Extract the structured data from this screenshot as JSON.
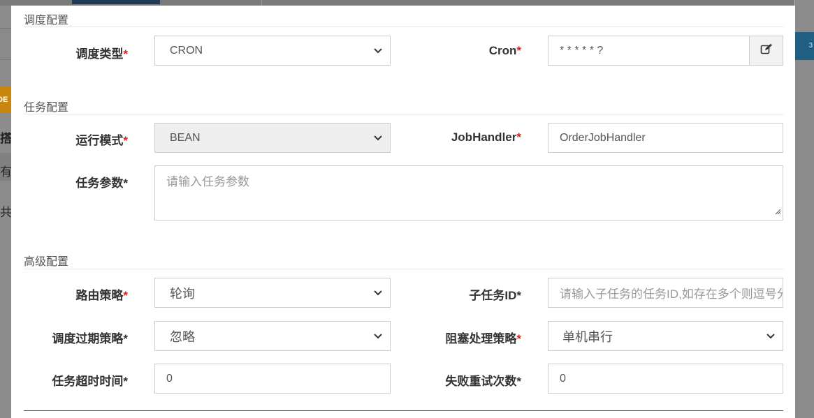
{
  "background": {
    "badge_text": "DE",
    "row1_text": "搭",
    "row2_text": "有",
    "row3_text": "共",
    "right_text": "3"
  },
  "sections": {
    "schedule": "调度配置",
    "task": "任务配置",
    "advanced": "高级配置"
  },
  "schedule": {
    "type_label": "调度类型",
    "type_value": "CRON",
    "cron_label": "Cron",
    "cron_value": "* * * * * ?"
  },
  "task": {
    "mode_label": "运行模式",
    "mode_value": "BEAN",
    "handler_label": "JobHandler",
    "handler_value": "OrderJobHandler",
    "param_label": "任务参数",
    "param_placeholder": "请输入任务参数"
  },
  "advanced": {
    "route_label": "路由策略",
    "route_value": "轮询",
    "child_label": "子任务ID",
    "child_placeholder": "请输入子任务的任务ID,如存在多个则逗号分隔",
    "misfire_label": "调度过期策略",
    "misfire_value": "忽略",
    "block_label": "阻塞处理策略",
    "block_value": "单机串行",
    "timeout_label": "任务超时时间",
    "timeout_value": "0",
    "retry_label": "失败重试次数",
    "retry_value": "0"
  },
  "required_mark": "*",
  "icons": {
    "select": "chevron-down-icon",
    "cron_edit": "edit-icon",
    "resize": "resize-handle-icon"
  },
  "colors": {
    "required": "#d9231d",
    "disabled_bg": "#eeeeee"
  }
}
